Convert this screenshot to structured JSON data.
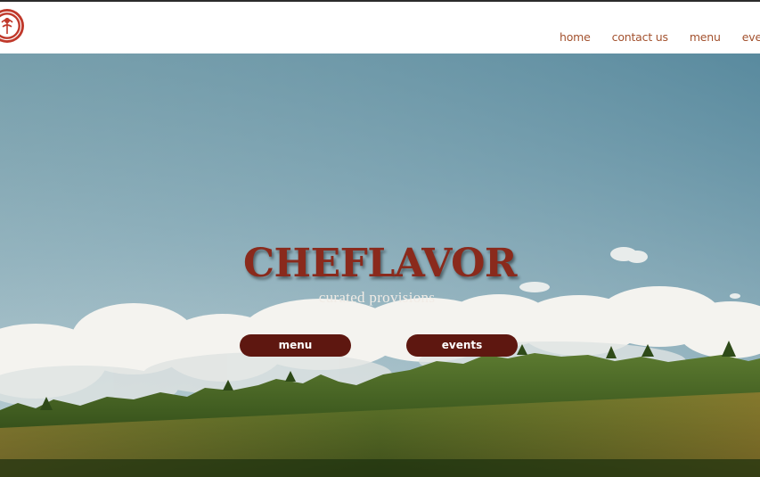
{
  "nav": {
    "items": [
      {
        "label": "home"
      },
      {
        "label": "contact us"
      },
      {
        "label": "menu"
      },
      {
        "label": "events"
      }
    ]
  },
  "logo": {
    "icon": "restaurant-logo-seal-icon",
    "color": "#c0392b"
  },
  "hero": {
    "title": "CHEFLAVOR",
    "subtitle": "curated provisions",
    "buttons": {
      "menu_label": "menu",
      "events_label": "events"
    }
  },
  "colors": {
    "nav_link": "#a3522f",
    "title": "#8a2a1c",
    "button_bg": "#5e1710",
    "button_text": "#ffffff",
    "sky_top": "#5d8ea3",
    "forest": "#3f5a22"
  }
}
